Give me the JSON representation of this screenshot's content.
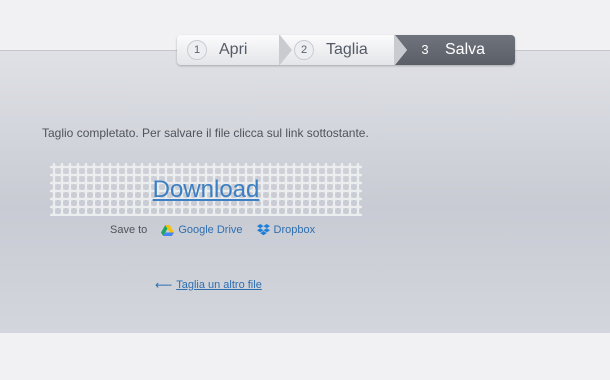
{
  "stepper": {
    "steps": [
      {
        "number": "1",
        "label": "Apri"
      },
      {
        "number": "2",
        "label": "Taglia"
      },
      {
        "number": "3",
        "label": "Salva"
      }
    ],
    "active_step": "3"
  },
  "main": {
    "message": "Taglio completato. Per salvare il file clicca sul link sottostante.",
    "download_label": "Download",
    "save_to_label": "Save to",
    "google_drive_label": "Google Drive",
    "dropbox_label": "Dropbox",
    "another_file_label": "Taglia un altro file",
    "arrow_glyph": "⟵"
  },
  "colors": {
    "link": "#2f6fb0",
    "download": "#3c7fc2",
    "active_step_bg": "#62666f"
  }
}
